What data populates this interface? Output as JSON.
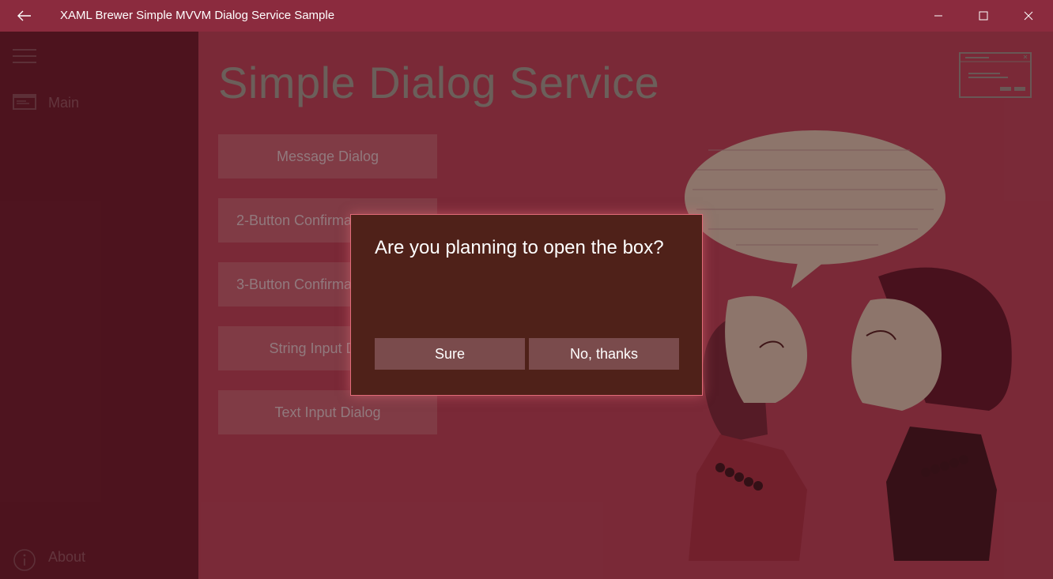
{
  "window": {
    "title": "XAML Brewer Simple MVVM Dialog Service Sample",
    "back_icon": "←",
    "minimize_icon": "–",
    "maximize_icon": "☐",
    "close_icon": "✕"
  },
  "sidebar": {
    "items": [
      {
        "label": "Main",
        "icon": "window-icon"
      },
      {
        "label": "About",
        "icon": "info-icon"
      }
    ]
  },
  "main": {
    "title": "Simple Dialog Service",
    "buttons": [
      {
        "label": "Message Dialog"
      },
      {
        "label": "2-Button Confirmation Dialog"
      },
      {
        "label": "3-Button Confirmation Dialog"
      },
      {
        "label": "String Input Dialog"
      },
      {
        "label": "Text Input Dialog"
      }
    ]
  },
  "dialog": {
    "question": "Are you planning to open the box?",
    "primary_label": "Sure",
    "secondary_label": "No, thanks"
  },
  "colors": {
    "titlebar": "#8b2b3e",
    "sidebar": "#791c2e",
    "content": "#a6384b",
    "dialog": "#4f2119",
    "dialog_border": "#e06b78"
  }
}
